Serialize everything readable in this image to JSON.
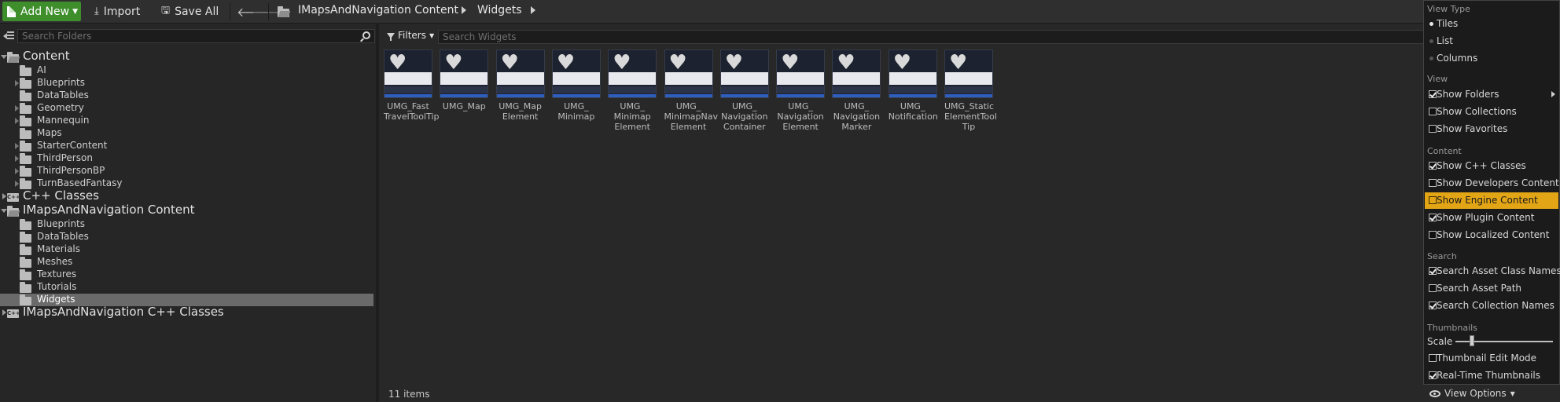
{
  "toolbar": {
    "add_new_label": "Add New",
    "import_label": "Import",
    "save_all_label": "Save All",
    "breadcrumbs": [
      "IMapsAndNavigation Content",
      "Widgets"
    ]
  },
  "left_panel": {
    "search_placeholder": "Search Folders",
    "tree": [
      {
        "label": "Content",
        "level": 0,
        "root": true,
        "expanded": true,
        "icon": "folder-open-icon"
      },
      {
        "label": "AI",
        "level": 1,
        "expandable": false
      },
      {
        "label": "Blueprints",
        "level": 1,
        "expandable": true
      },
      {
        "label": "DataTables",
        "level": 1,
        "expandable": false
      },
      {
        "label": "Geometry",
        "level": 1,
        "expandable": true
      },
      {
        "label": "Mannequin",
        "level": 1,
        "expandable": true
      },
      {
        "label": "Maps",
        "level": 1,
        "expandable": false
      },
      {
        "label": "StarterContent",
        "level": 1,
        "expandable": true
      },
      {
        "label": "ThirdPerson",
        "level": 1,
        "expandable": true
      },
      {
        "label": "ThirdPersonBP",
        "level": 1,
        "expandable": true
      },
      {
        "label": "TurnBasedFantasy",
        "level": 1,
        "expandable": true
      },
      {
        "label": "C++ Classes",
        "level": 0,
        "root": true,
        "expanded": false,
        "icon": "cpp-folder-icon"
      },
      {
        "label": "IMapsAndNavigation Content",
        "level": 0,
        "root": true,
        "expanded": true,
        "icon": "folder-open-icon"
      },
      {
        "label": "Blueprints",
        "level": 1,
        "expandable": false
      },
      {
        "label": "DataTables",
        "level": 1,
        "expandable": false
      },
      {
        "label": "Materials",
        "level": 1,
        "expandable": false
      },
      {
        "label": "Meshes",
        "level": 1,
        "expandable": false
      },
      {
        "label": "Textures",
        "level": 1,
        "expandable": false
      },
      {
        "label": "Tutorials",
        "level": 1,
        "expandable": false
      },
      {
        "label": "Widgets",
        "level": 1,
        "expandable": false,
        "selected": true
      },
      {
        "label": "IMapsAndNavigation C++ Classes",
        "level": 0,
        "root": true,
        "expanded": false,
        "icon": "cpp-folder-icon"
      }
    ]
  },
  "main": {
    "filters_label": "Filters",
    "search_placeholder": "Search Widgets",
    "assets": [
      {
        "name": "UMG_Fast\nTravelToolTip"
      },
      {
        "name": "UMG_Map"
      },
      {
        "name": "UMG_Map\nElement"
      },
      {
        "name": "UMG_\nMinimap"
      },
      {
        "name": "UMG_\nMinimap\nElement"
      },
      {
        "name": "UMG_\nMinimapNav\nElement"
      },
      {
        "name": "UMG_\nNavigation\nContainer"
      },
      {
        "name": "UMG_\nNavigation\nElement"
      },
      {
        "name": "UMG_\nNavigation\nMarker"
      },
      {
        "name": "UMG_\nNotification"
      },
      {
        "name": "UMG_Static\nElementTool\nTip"
      }
    ],
    "item_count": "11 items",
    "view_options_label": "View Options"
  },
  "view_menu": {
    "sections": {
      "view_type": "View Type",
      "view": "View",
      "content": "Content",
      "search": "Search",
      "thumbnails": "Thumbnails"
    },
    "view_type": [
      {
        "label": "Tiles",
        "selected": true
      },
      {
        "label": "List",
        "selected": false
      },
      {
        "label": "Columns",
        "selected": false
      }
    ],
    "view": [
      {
        "label": "Show Folders",
        "checked": true,
        "submenu": true
      },
      {
        "label": "Show Collections",
        "checked": false
      },
      {
        "label": "Show Favorites",
        "checked": false
      }
    ],
    "content": [
      {
        "label": "Show C++ Classes",
        "checked": true
      },
      {
        "label": "Show Developers Content",
        "checked": false
      },
      {
        "label": "Show Engine Content",
        "checked": false,
        "highlighted": true
      },
      {
        "label": "Show Plugin Content",
        "checked": true
      },
      {
        "label": "Show Localized Content",
        "checked": false
      }
    ],
    "search": [
      {
        "label": "Search Asset Class Names",
        "checked": true
      },
      {
        "label": "Search Asset Path",
        "checked": false
      },
      {
        "label": "Search Collection Names",
        "checked": true
      }
    ],
    "thumbnails": {
      "scale_label": "Scale",
      "scale_value": 0.17,
      "items": [
        {
          "label": "Thumbnail Edit Mode",
          "checked": false
        },
        {
          "label": "Real-Time Thumbnails",
          "checked": true
        }
      ]
    }
  },
  "colors": {
    "accent_green": "#3e8e2c",
    "highlight_orange": "#e2a516",
    "selection_gray": "#6a6a6a"
  }
}
